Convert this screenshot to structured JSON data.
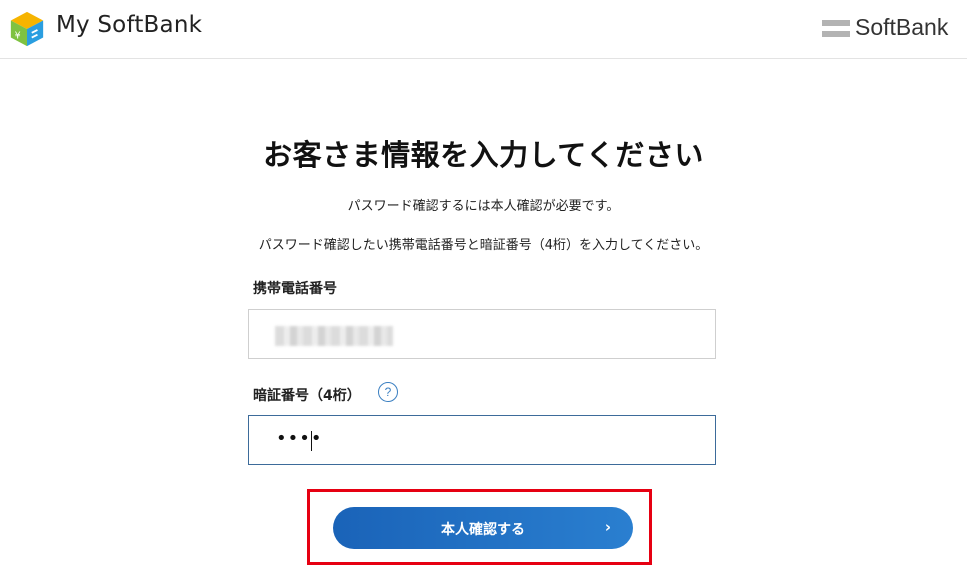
{
  "header": {
    "app_name": "My SoftBank",
    "brand_name": "SoftBank",
    "logo_icon": "my-softbank-cube-logo",
    "brand_icon": "softbank-bars-logo"
  },
  "main": {
    "title": "お客さま情報を入力してください",
    "note1": "パスワード確認するには本人確認が必要です。",
    "note2": "パスワード確認したい携帯電話番号と暗証番号（4桁）を入力してください。",
    "phone": {
      "label": "携帯電話番号",
      "value_note": "blurred"
    },
    "pin": {
      "label": "暗証番号（4桁）",
      "value": "••••",
      "help_icon": "question-circle-icon",
      "help_glyph": "?"
    },
    "confirm_button": {
      "label": "本人確認する",
      "icon": "chevron-right-icon",
      "glyph": "›"
    }
  },
  "colors": {
    "button": "#1a63b8",
    "highlight": "#e60012",
    "help": "#3a7fc1"
  }
}
